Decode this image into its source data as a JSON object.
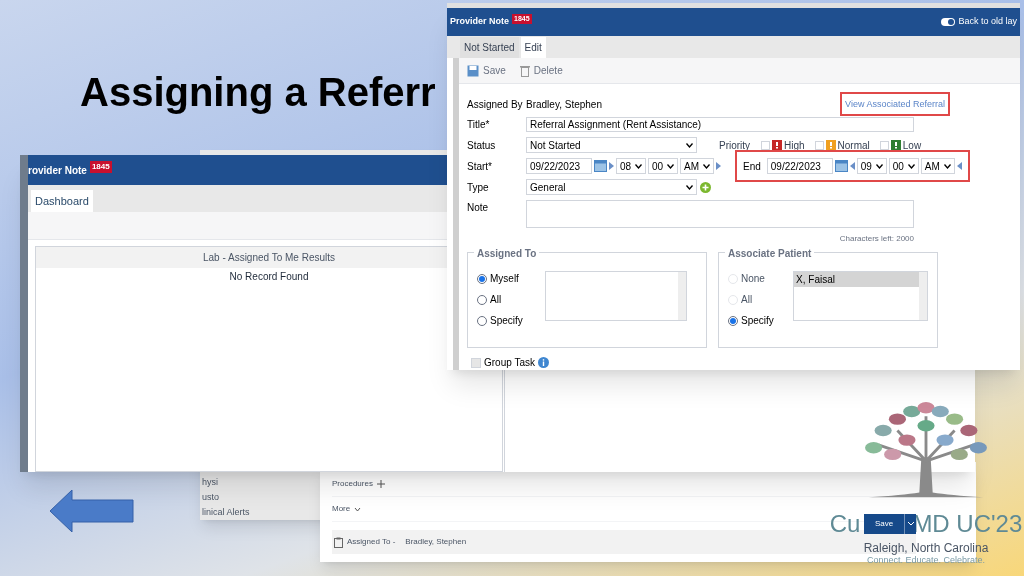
{
  "slide": {
    "title": "Assigning a Referr"
  },
  "back_window": {
    "sidebar_items": [
      "hysi",
      "usto",
      "linical Alerts"
    ]
  },
  "bottom_window": {
    "sections": [
      {
        "kind": "add",
        "label": "Procedures"
      },
      {
        "kind": "expand",
        "label": "More"
      }
    ],
    "assigned_label": "Assigned To -",
    "assigned_value": "Bradley, Stephen",
    "save_button": "Save"
  },
  "dashboard_window": {
    "title": "rovider Note",
    "badge": "1845",
    "tabs": [
      {
        "label": "Dashboard",
        "selected": true
      }
    ],
    "panel_title": "Lab - Assigned To Me Results",
    "empty_message": "No Record Found"
  },
  "note_window": {
    "title": "Provider Note",
    "badge": "1845",
    "toggle": {
      "label": "Back to old lay",
      "on": true
    },
    "tabs": [
      {
        "label": "Not Started",
        "selected": false
      },
      {
        "label": "Edit",
        "selected": true
      }
    ],
    "toolbar": [
      {
        "kind": "save",
        "label": "Save"
      },
      {
        "kind": "delete",
        "label": "Delete"
      }
    ],
    "assigned_by": {
      "label": "Assigned By",
      "value": "Bradley, Stephen"
    },
    "link": "View Associated Referral",
    "title_field": {
      "label": "Title*",
      "value": "Referral Assignment (Rent Assistance)"
    },
    "status": {
      "label": "Status",
      "value": "Not Started"
    },
    "priority": {
      "label": "Priority",
      "options": [
        {
          "label": "High",
          "color": "#c62828",
          "checked": false
        },
        {
          "label": "Normal",
          "color": "#f0a020",
          "checked": false
        },
        {
          "label": "Low",
          "color": "#2e7d32",
          "checked": false
        }
      ]
    },
    "start": {
      "label": "Start*",
      "date": "09/22/2023",
      "hour": "08",
      "minute": "00",
      "ampm": "AM"
    },
    "end": {
      "label": "End",
      "date": "09/22/2023",
      "hour": "09",
      "minute": "00",
      "ampm": "AM"
    },
    "type": {
      "label": "Type",
      "value": "General"
    },
    "note": {
      "label": "Note"
    },
    "chars_left": "Characters left: 2000",
    "assigned_to": {
      "legend": "Assigned To",
      "options": [
        {
          "label": "Myself",
          "selected": true,
          "disabled": false
        },
        {
          "label": "All",
          "selected": false,
          "disabled": false
        },
        {
          "label": "Specify",
          "selected": false,
          "disabled": false
        }
      ]
    },
    "associate_patient": {
      "legend": "Associate Patient",
      "options": [
        {
          "label": "None",
          "selected": false,
          "disabled": true
        },
        {
          "label": "All",
          "selected": false,
          "disabled": true
        },
        {
          "label": "Specify",
          "selected": true,
          "disabled": false
        }
      ],
      "list_items": [
        {
          "label": "X, Faisal",
          "selected": true
        }
      ]
    },
    "group_task": {
      "label": "Group Task",
      "checked": false
    }
  },
  "logo": {
    "name_parts": [
      "Cu",
      "MD UC'23"
    ],
    "location": "Raleigh, North Carolina",
    "tagline": "Connect. Educate. Celebrate."
  }
}
